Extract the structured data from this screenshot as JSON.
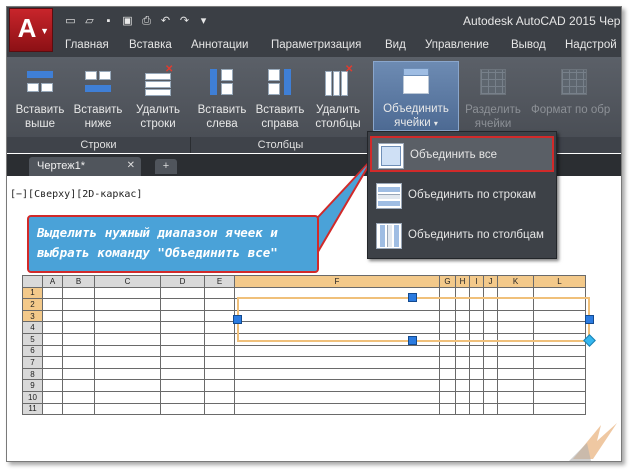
{
  "app": {
    "logo_letter": "A",
    "title": "Autodesk AutoCAD 2015   Чер"
  },
  "qat": [
    "new-icon",
    "open-icon",
    "save-icon",
    "save-as-icon",
    "plot-icon",
    "undo-icon",
    "redo-icon",
    "customize-icon"
  ],
  "tabs": [
    "Главная",
    "Вставка",
    "Аннотации",
    "Параметризация",
    "Вид",
    "Управление",
    "Вывод",
    "Надстрой"
  ],
  "ribbon": {
    "rows_buttons": [
      {
        "label1": "Вставить",
        "label2": "выше"
      },
      {
        "label1": "Вставить",
        "label2": "ниже"
      },
      {
        "label1": "Удалить",
        "label2": "строки"
      }
    ],
    "cols_buttons": [
      {
        "label1": "Вставить",
        "label2": "слева"
      },
      {
        "label1": "Вставить",
        "label2": "справа"
      },
      {
        "label1": "Удалить",
        "label2": "столбцы"
      }
    ],
    "merge": {
      "label1": "Объединить",
      "label2": "ячейки"
    },
    "unmerge": {
      "label1": "Разделить",
      "label2": "ячейки"
    },
    "format": {
      "label1": "Формат по обр"
    },
    "panels": {
      "rows": "Строки",
      "cols": "Столбцы"
    }
  },
  "doc": {
    "tab_label": "Чертеж1*",
    "close": "✕",
    "new_tab": "+"
  },
  "viewport_label": "[−][Сверху][2D-каркас]",
  "dropdown": {
    "all": "Объединить все",
    "rows": "Объединить по строкам",
    "cols": "Объединить по столбцам"
  },
  "callout": {
    "line1": "Выделить нужный диапазон ячеек и",
    "line2": "выбрать команду \"Объединить все\""
  },
  "sheet": {
    "columns": [
      "A",
      "B",
      "C",
      "D",
      "E",
      "F",
      "G",
      "H",
      "I",
      "J",
      "K",
      "L"
    ],
    "rows": [
      "1",
      "2",
      "3",
      "4",
      "5",
      "6",
      "7",
      "8",
      "9",
      "10",
      "11"
    ],
    "selected_columns": [
      "F",
      "G",
      "H",
      "I",
      "J",
      "K",
      "L"
    ],
    "selected_rows": [
      "1",
      "2",
      "3"
    ]
  },
  "colors": {
    "accent_red": "#d12a2a",
    "callout_blue": "#4aa2d8",
    "selection_orange": "#f3c98a"
  }
}
